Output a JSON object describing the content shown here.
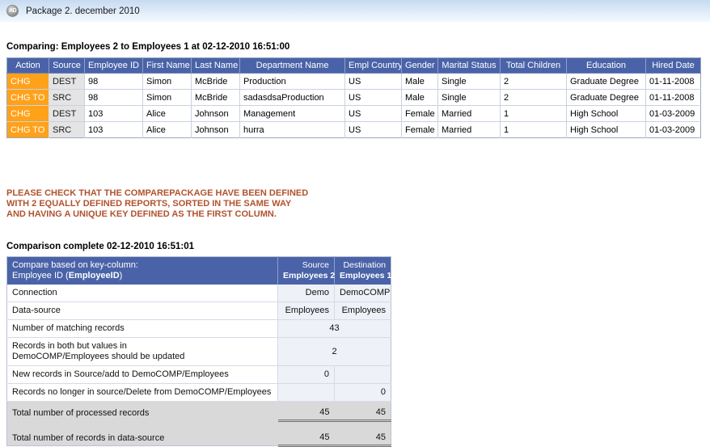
{
  "titlebar": {
    "icon": "app-circle-icon",
    "icon_text": "AD",
    "title": "Package 2. december 2010"
  },
  "report": {
    "comparing_line": "Comparing: Employees 2 to Employees 1 at 02-12-2010 16:51:00",
    "warning_lines": [
      "PLEASE CHECK THAT THE COMPAREPACKAGE HAVE BEEN DEFINED",
      "WITH 2 EQUALLY DEFINED REPORTS, SORTED IN THE SAME WAY",
      "AND HAVING A UNIQUE KEY DEFINED AS THE FIRST COLUMN."
    ],
    "complete_line": "Comparison complete 02-12-2010 16:51:01"
  },
  "diff_table": {
    "columns": [
      "Action",
      "Source",
      "Employee ID",
      "First Name",
      "Last Name",
      "Department Name",
      "Empl Country",
      "Gender",
      "Marital Status",
      "Total Children",
      "Education",
      "Hired Date"
    ],
    "rows": [
      [
        "CHG",
        "DEST",
        "98",
        "Simon",
        "McBride",
        "Production",
        "US",
        "Male",
        "Single",
        "2",
        "Graduate Degree",
        "01-11-2008"
      ],
      [
        "CHG TO",
        "SRC",
        "98",
        "Simon",
        "McBride",
        "sadasdsaProduction",
        "US",
        "Male",
        "Single",
        "2",
        "Graduate Degree",
        "01-11-2008"
      ],
      [
        "CHG",
        "DEST",
        "103",
        "Alice",
        "Johnson",
        "Management",
        "US",
        "Female",
        "Married",
        "1",
        "High School",
        "01-03-2009"
      ],
      [
        "CHG TO",
        "SRC",
        "103",
        "Alice",
        "Johnson",
        "hurra",
        "US",
        "Female",
        "Married",
        "1",
        "High School",
        "01-03-2009"
      ]
    ]
  },
  "summary_table": {
    "key_header_line1": "Compare based on key-column:",
    "key_header_line2_prefix": "Employee ID (",
    "key_header_line2_bold": "EmployeeID",
    "key_header_line2_suffix": ")",
    "source_col_name": "Source",
    "source_col_value": "Employees 2",
    "dest_col_name": "Destination",
    "dest_col_value": "Employees 1",
    "rows": [
      {
        "label": "Connection",
        "source": "Demo",
        "destination": "DemoCOMP",
        "span": false
      },
      {
        "label": "Data-source",
        "source": "Employees",
        "destination": "Employees",
        "span": false
      },
      {
        "label": "Number of matching records",
        "span_value": "43",
        "span": true
      },
      {
        "label_line1": "Records in both but values in",
        "label_line2": "DemoCOMP/Employees should be updated",
        "span_value": "2",
        "span": true
      },
      {
        "label": "New records in Source/add to DemoCOMP/Employees",
        "source": "0",
        "destination": "",
        "span": false
      },
      {
        "label": "Records no longer in source/Delete from DemoCOMP/Employees",
        "source": "",
        "destination": "0",
        "span": false
      }
    ],
    "totals": [
      {
        "label": "Total number of processed records",
        "source": "45",
        "destination": "45"
      },
      {
        "label": "Total number of records in data-source",
        "source": "45",
        "destination": "45"
      }
    ]
  },
  "colors": {
    "header_blue": "#4a63a8",
    "action_orange": "#ffa21a",
    "warning_brown": "#b1522c",
    "value_cell": "#eef1f7",
    "total_row": "#d9d9d9"
  }
}
